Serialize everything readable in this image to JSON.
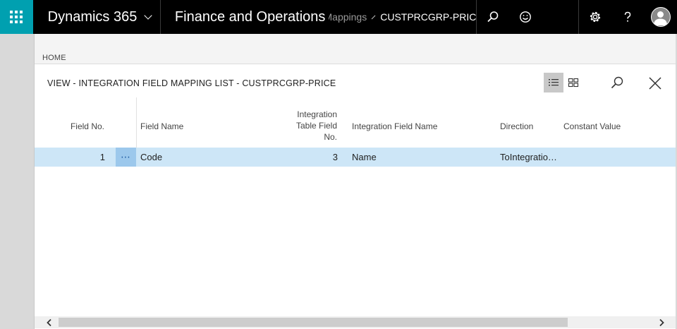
{
  "nav": {
    "brand": "Dynamics 365",
    "module": "Finance and Operations",
    "breadcrumb_prev": "Mappings",
    "breadcrumb_current": "CUSTPRCGRP-PRICE",
    "icons": [
      "waffle-icon",
      "search-icon",
      "smiley-icon",
      "gear-icon",
      "help-icon",
      "user-icon"
    ]
  },
  "homebar": {
    "label": "HOME"
  },
  "dialog": {
    "title": "VIEW - INTEGRATION FIELD MAPPING LIST - CUSTPRCGRP-PRICE"
  },
  "grid": {
    "columns": {
      "field_no": "Field No.",
      "field_name": "Field Name",
      "int_table_field_no_1": "Integration",
      "int_table_field_no_2": "Table Field",
      "int_table_field_no_3": "No.",
      "int_field_name": "Integration Field Name",
      "direction": "Direction",
      "constant_value": "Constant Value"
    },
    "rows": [
      {
        "field_no": "1",
        "row_menu": "⋯",
        "field_name": "Code",
        "int_table_field_no": "3",
        "int_field_name": "Name",
        "direction": "ToIntegratio…",
        "constant_value": ""
      }
    ]
  },
  "colors": {
    "accent": "#00a0b0",
    "topbar": "#000000",
    "row_selected": "#cde6f7",
    "row_menu_bg": "#9cc8ec"
  }
}
